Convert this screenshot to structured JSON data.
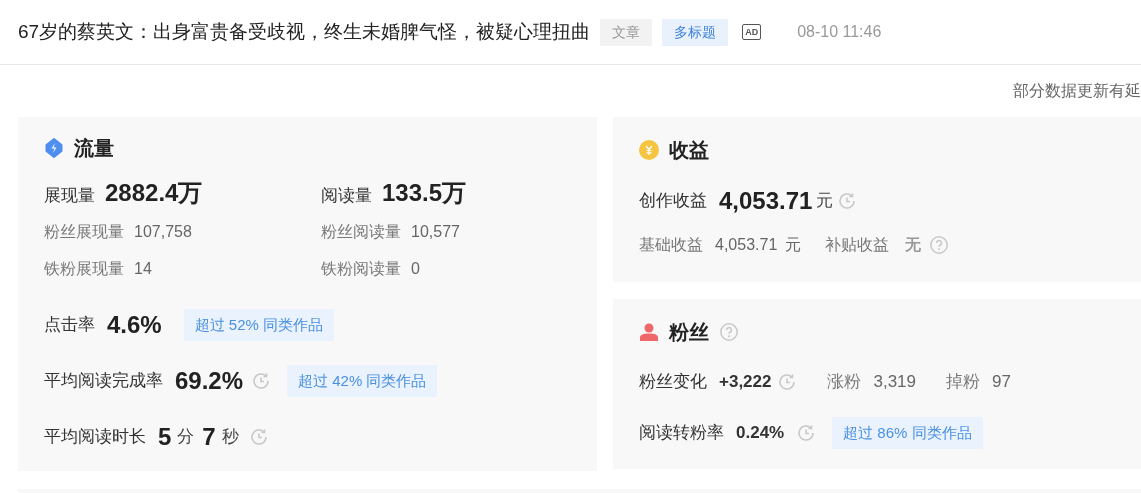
{
  "header": {
    "title": "67岁的蔡英文：出身富贵备受歧视，终生未婚脾气怪，被疑心理扭曲",
    "tags": [
      {
        "label": "文章",
        "kind": "plain"
      },
      {
        "label": "多标题",
        "kind": "blue"
      }
    ],
    "ad_badge": "AD",
    "time": "08-10 11:46"
  },
  "notice": "部分数据更新有延",
  "traffic": {
    "title": "流量",
    "primary": [
      {
        "label": "展现量",
        "value": "2882.4万"
      },
      {
        "label": "阅读量",
        "value": "133.5万"
      }
    ],
    "secondary": [
      {
        "label": "粉丝展现量",
        "value": "107,758"
      },
      {
        "label": "粉丝阅读量",
        "value": "10,577"
      },
      {
        "label": "铁粉展现量",
        "value": "14"
      },
      {
        "label": "铁粉阅读量",
        "value": "0"
      }
    ],
    "rates": [
      {
        "label": "点击率",
        "parts": [
          {
            "text": "4.6%",
            "kind": "num"
          }
        ],
        "clock": false,
        "badge": "超过 52% 同类作品"
      },
      {
        "label": "平均阅读完成率",
        "parts": [
          {
            "text": "69.2%",
            "kind": "num"
          }
        ],
        "clock": true,
        "badge": "超过 42% 同类作品"
      },
      {
        "label": "平均阅读时长",
        "parts": [
          {
            "text": "5",
            "kind": "num"
          },
          {
            "text": "分",
            "kind": "unit"
          },
          {
            "text": "7",
            "kind": "num"
          },
          {
            "text": "秒",
            "kind": "unit"
          }
        ],
        "clock": true
      }
    ]
  },
  "income": {
    "title": "收益",
    "main": {
      "label": "创作收益",
      "value": "4,053.71",
      "unit": "元",
      "clock": true
    },
    "items": [
      {
        "label": "基础收益",
        "value": "4,053.71",
        "unit": "元",
        "help": false
      },
      {
        "label": "补贴收益",
        "value": "无",
        "help": true
      }
    ]
  },
  "fans": {
    "title": "粉丝",
    "help": true,
    "change": {
      "label": "粉丝变化",
      "value": "+3,222",
      "clock": true
    },
    "items": [
      {
        "label": "涨粉",
        "value": "3,319"
      },
      {
        "label": "掉粉",
        "value": "97"
      }
    ],
    "rate": {
      "label": "阅读转粉率",
      "value": "0.24%",
      "clock": true,
      "badge": "超过 86% 同类作品"
    }
  }
}
